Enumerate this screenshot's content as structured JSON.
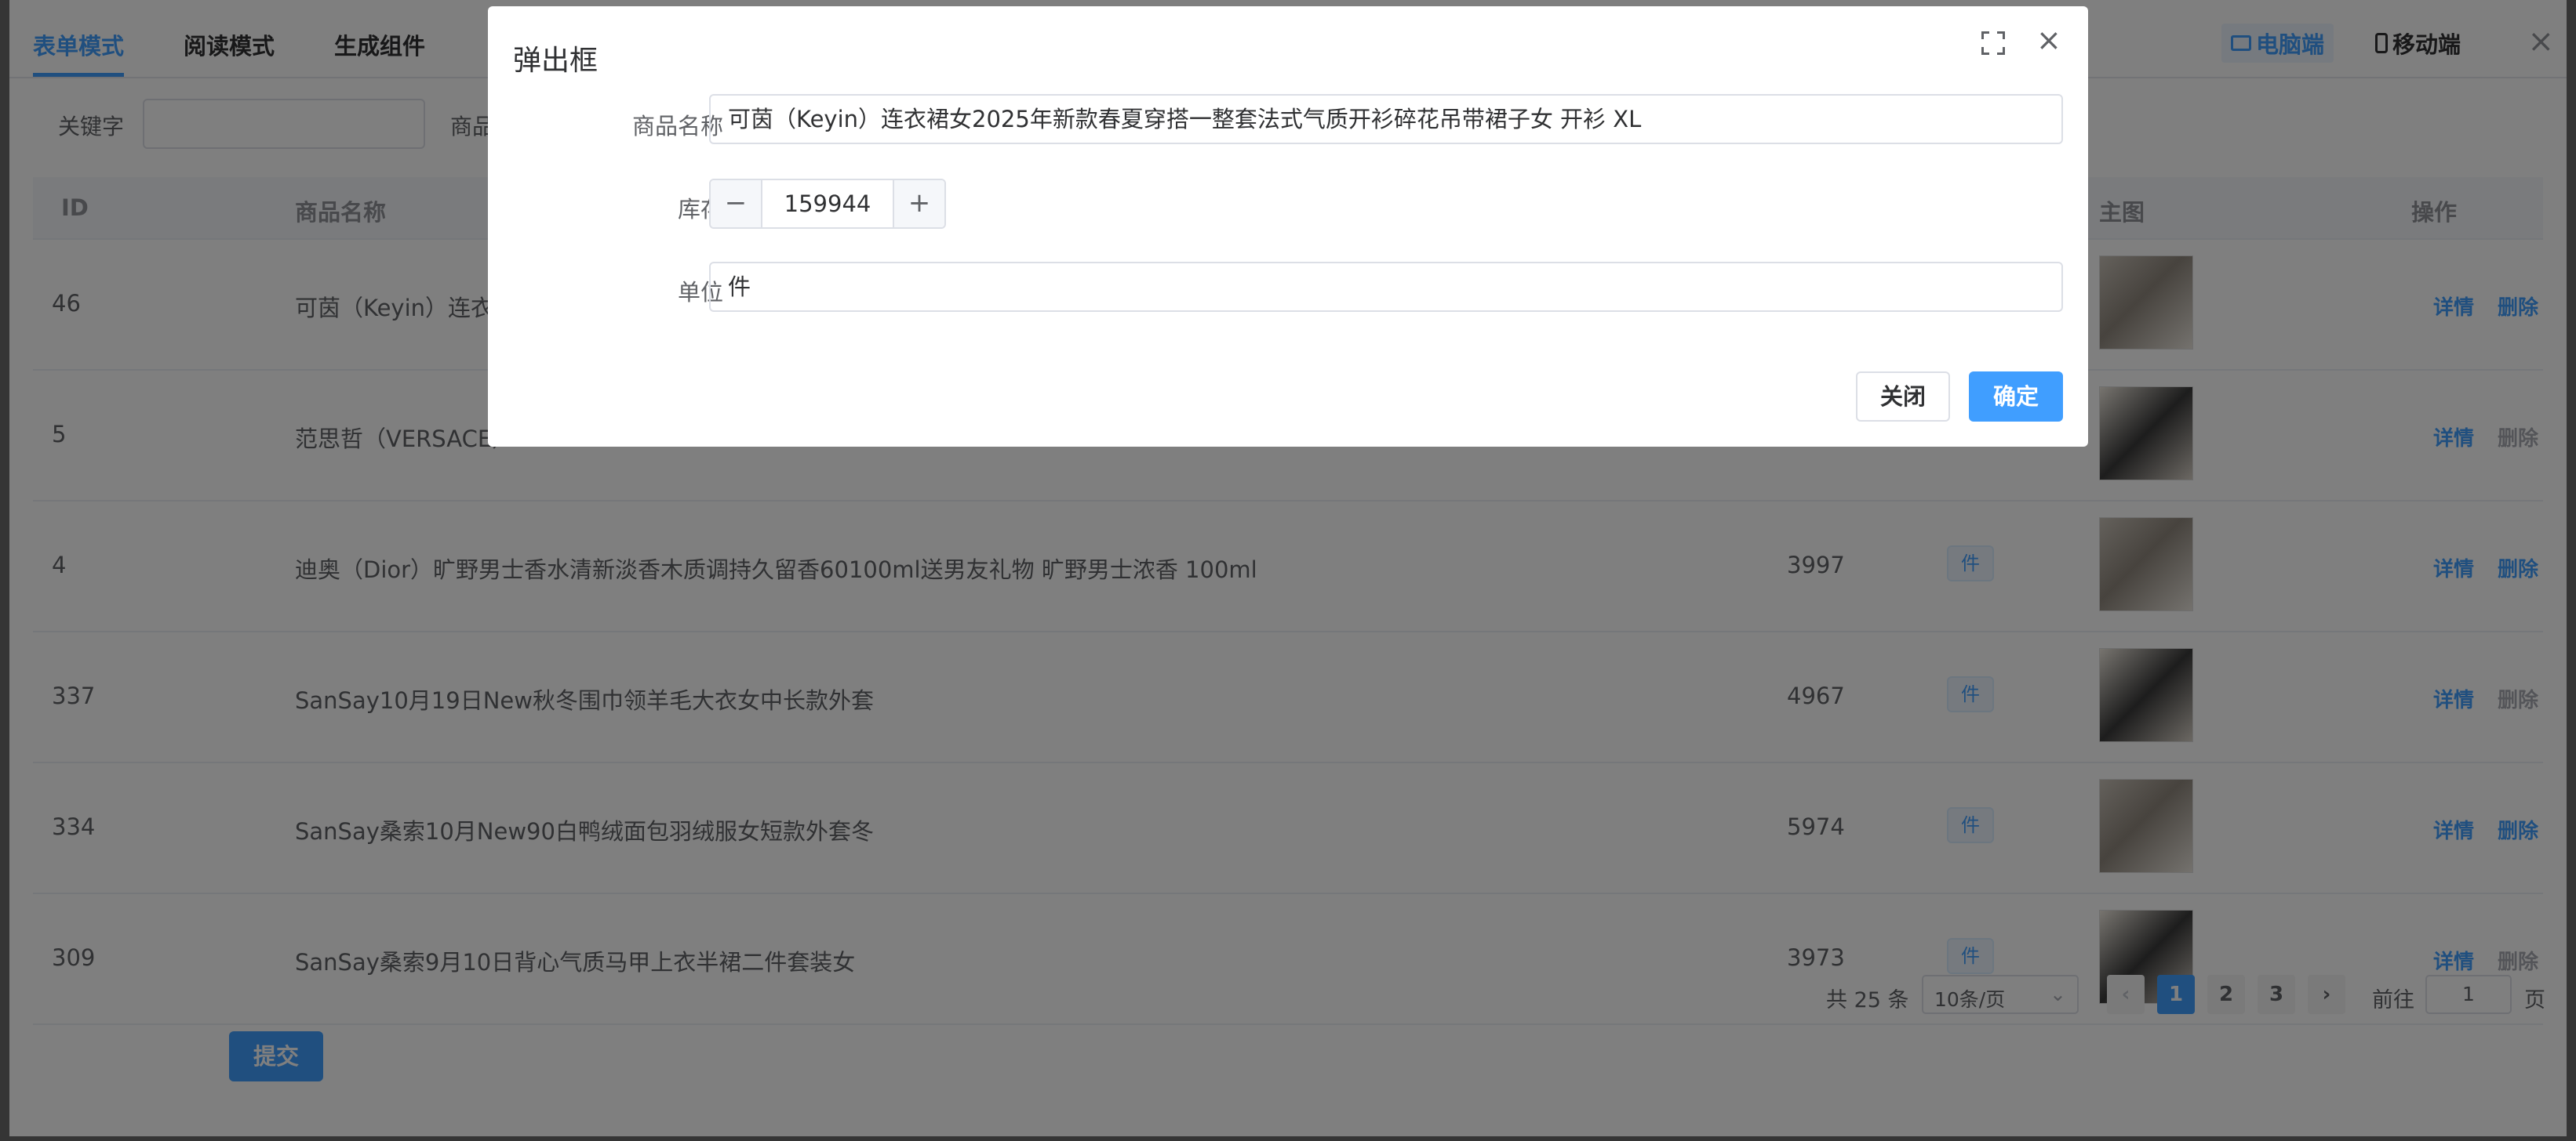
{
  "tabs": [
    "表单模式",
    "阅读模式",
    "生成组件"
  ],
  "device": {
    "pc": "电脑端",
    "mobile": "移动端"
  },
  "filters": {
    "keyword_label": "关键字",
    "name_label": "商品"
  },
  "table": {
    "headers": {
      "id": "ID",
      "name": "商品名称",
      "image": "主图",
      "op": "操作"
    },
    "rows": [
      {
        "id": "46",
        "name": "可茵（Keyin）连衣裙",
        "stock": "",
        "unit": "",
        "delete_enabled": true
      },
      {
        "id": "5",
        "name": "范思哲（VERSACE）",
        "stock": "",
        "unit": "",
        "delete_enabled": false
      },
      {
        "id": "4",
        "name": "迪奥（Dior）旷野男士香水清新淡香木质调持久留香60100ml送男友礼物 旷野男士浓香 100ml",
        "stock": "3997",
        "unit": "件",
        "delete_enabled": true
      },
      {
        "id": "337",
        "name": "SanSay10月19日New秋冬围巾领羊毛大衣女中长款外套",
        "stock": "4967",
        "unit": "件",
        "delete_enabled": false
      },
      {
        "id": "334",
        "name": "SanSay桑索10月New90白鸭绒面包羽绒服女短款外套冬",
        "stock": "5974",
        "unit": "件",
        "delete_enabled": true
      },
      {
        "id": "309",
        "name": "SanSay桑索9月10日背心气质马甲上衣半裙二件套装女",
        "stock": "3973",
        "unit": "件",
        "delete_enabled": false
      }
    ],
    "detail_label": "详情",
    "delete_label": "删除"
  },
  "pagination": {
    "total": "共 25 条",
    "page_size": "10条/页",
    "pages": [
      "1",
      "2",
      "3"
    ],
    "current": "1",
    "goto_label": "前往",
    "goto_value": "1",
    "page_unit": "页",
    "prev": "‹",
    "next": "›"
  },
  "submit_label": "提交",
  "dialog": {
    "title": "弹出框",
    "fields": {
      "name_label": "商品名称",
      "name_value": "可茵（Keyin）连衣裙女2025年新款春夏穿搭一整套法式气质开衫碎花吊带裙子女 开衫 XL",
      "stock_label": "库存",
      "stock_value": "159944",
      "unit_label": "单位",
      "unit_value": "件"
    },
    "stepper": {
      "minus": "−",
      "plus": "+"
    },
    "close_label": "关闭",
    "ok_label": "确定"
  },
  "colors": {
    "primary": "#409eff",
    "mask": "rgba(0,0,0,0.5)"
  }
}
